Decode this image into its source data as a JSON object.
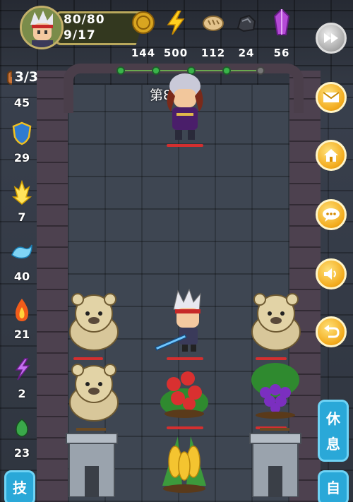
{
  "hud": {
    "hp": "80/80",
    "floor": "9/17",
    "resources": [
      {
        "icon": "gold-coin-icon",
        "value": "144"
      },
      {
        "icon": "lightning-energy-icon",
        "value": "500"
      },
      {
        "icon": "bread-food-icon",
        "value": "112"
      },
      {
        "icon": "ore-rock-icon",
        "value": "24"
      },
      {
        "icon": "purple-crystal-icon",
        "value": "56"
      }
    ]
  },
  "round_label": "第8回合",
  "left_stats": [
    {
      "icon": "fist-attack-icon",
      "value": "3/3"
    },
    {
      "icon": "shield-defense-icon",
      "value": "45"
    },
    {
      "icon": "light-holy-icon",
      "value": "29"
    },
    {
      "icon": "water-wave-icon",
      "value": "7"
    },
    {
      "icon": "fire-flame-icon",
      "value": "40"
    },
    {
      "icon": "lightning-purple-icon",
      "value": "21"
    },
    {
      "icon": "poison-green-icon",
      "value": "2"
    },
    {
      "icon": "",
      "value": "23"
    }
  ],
  "right_buttons": [
    "fast-forward-icon",
    "mail-icon",
    "home-icon",
    "chat-icon",
    "sound-icon",
    "back-icon"
  ],
  "tabs": {
    "rest_label_1": "休",
    "rest_label_2": "息",
    "auto_label": "自",
    "skill_label": "技"
  },
  "colors": {
    "accent": "#f2a91a",
    "tab": "#2aa8d8",
    "hp": "#d32f2f"
  }
}
